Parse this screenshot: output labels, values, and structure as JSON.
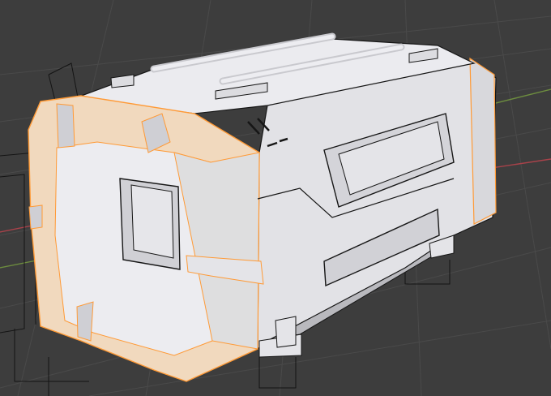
{
  "viewport": {
    "background": "#3d3d3d",
    "grid_color": "#4a4a4a",
    "x_axis_color": "#a9424a",
    "y_axis_color": "#6d8d3f"
  },
  "model": {
    "shell_color": "#e4e4e8",
    "shadow_color": "#c8c8cc",
    "outline_color": "#161616",
    "selected_color": "#ff9a36",
    "selected_face_tint": "#f1d9be"
  }
}
